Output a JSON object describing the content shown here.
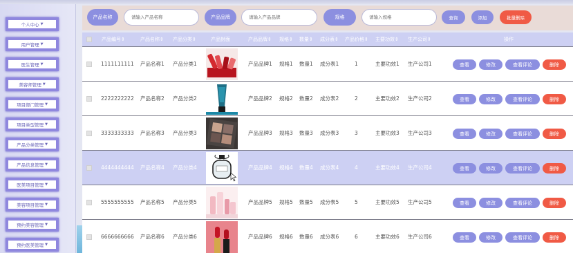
{
  "sidebar": {
    "items": [
      {
        "label": "个人中心"
      },
      {
        "label": "用户管理"
      },
      {
        "label": "医生管理"
      },
      {
        "label": "美容师管理"
      },
      {
        "label": "项目部门管理"
      },
      {
        "label": "项目类型管理"
      },
      {
        "label": "产品分类管理"
      },
      {
        "label": "产品信息管理"
      },
      {
        "label": "医美项目管理"
      },
      {
        "label": "美容项目管理"
      },
      {
        "label": "预约美容管理"
      },
      {
        "label": "预约医美管理"
      }
    ]
  },
  "search": {
    "name_label": "产品名称",
    "name_placeholder": "请输入产品名称",
    "brand_label": "产品品牌",
    "brand_placeholder": "请输入产品品牌",
    "spec_label": "规格",
    "spec_placeholder": "请输入规格",
    "query_label": "查询",
    "add_label": "添加",
    "batch_delete_label": "批量删除"
  },
  "table": {
    "columns": [
      "产品编号",
      "产品名称",
      "产品分类",
      "产品封面",
      "产品品牌",
      "规格",
      "数量",
      "成分表",
      "产品价格",
      "主要功效",
      "生产公司",
      "操作"
    ],
    "sort_mark": "⇕",
    "actions": {
      "view": "查看",
      "edit": "修改",
      "review": "查看评论",
      "delete": "删除"
    },
    "rows": [
      {
        "id": "1111111111",
        "name": "产品名称1",
        "category": "产品分类1",
        "cover": "lipstick-palette",
        "brand": "产品品牌1",
        "spec": "规格1",
        "qty": "数量1",
        "ingredients": "成分表1",
        "price": "1",
        "effect": "主要功效1",
        "company": "生产公司1"
      },
      {
        "id": "2222222222",
        "name": "产品名称2",
        "category": "产品分类2",
        "cover": "blue-tube",
        "brand": "产品品牌2",
        "spec": "规格2",
        "qty": "数量2",
        "ingredients": "成分表2",
        "price": "2",
        "effect": "主要功效2",
        "company": "生产公司2"
      },
      {
        "id": "3333333333",
        "name": "产品名称3",
        "category": "产品分类3",
        "cover": "eyeshadow-palette",
        "brand": "产品品牌3",
        "spec": "规格3",
        "qty": "数量3",
        "ingredients": "成分表3",
        "price": "3",
        "effect": "主要功效3",
        "company": "生产公司3"
      },
      {
        "id": "4444444444",
        "name": "产品名称4",
        "category": "产品分类4",
        "cover": "perfume-bottle",
        "brand": "产品品牌4",
        "spec": "规格4",
        "qty": "数量4",
        "ingredients": "成分表4",
        "price": "4",
        "effect": "主要功效4",
        "company": "生产公司4"
      },
      {
        "id": "5555555555",
        "name": "产品名称5",
        "category": "产品分类5",
        "cover": "pink-cosmetics",
        "brand": "产品品牌5",
        "spec": "规格5",
        "qty": "数量5",
        "ingredients": "成分表5",
        "price": "5",
        "effect": "主要功效5",
        "company": "生产公司5"
      },
      {
        "id": "6666666666",
        "name": "产品名称6",
        "category": "产品分类6",
        "cover": "red-lipstick",
        "brand": "产品品牌6",
        "spec": "规格6",
        "qty": "数量6",
        "ingredients": "成分表6",
        "price": "6",
        "effect": "主要功效6",
        "company": "生产公司6"
      }
    ]
  },
  "colors": {
    "accent": "#8c8fe0",
    "danger": "#f05a45",
    "header_bg": "#cdd0f3",
    "search_bg": "#e9dbd7",
    "sidebar_border": "#8f87de"
  }
}
